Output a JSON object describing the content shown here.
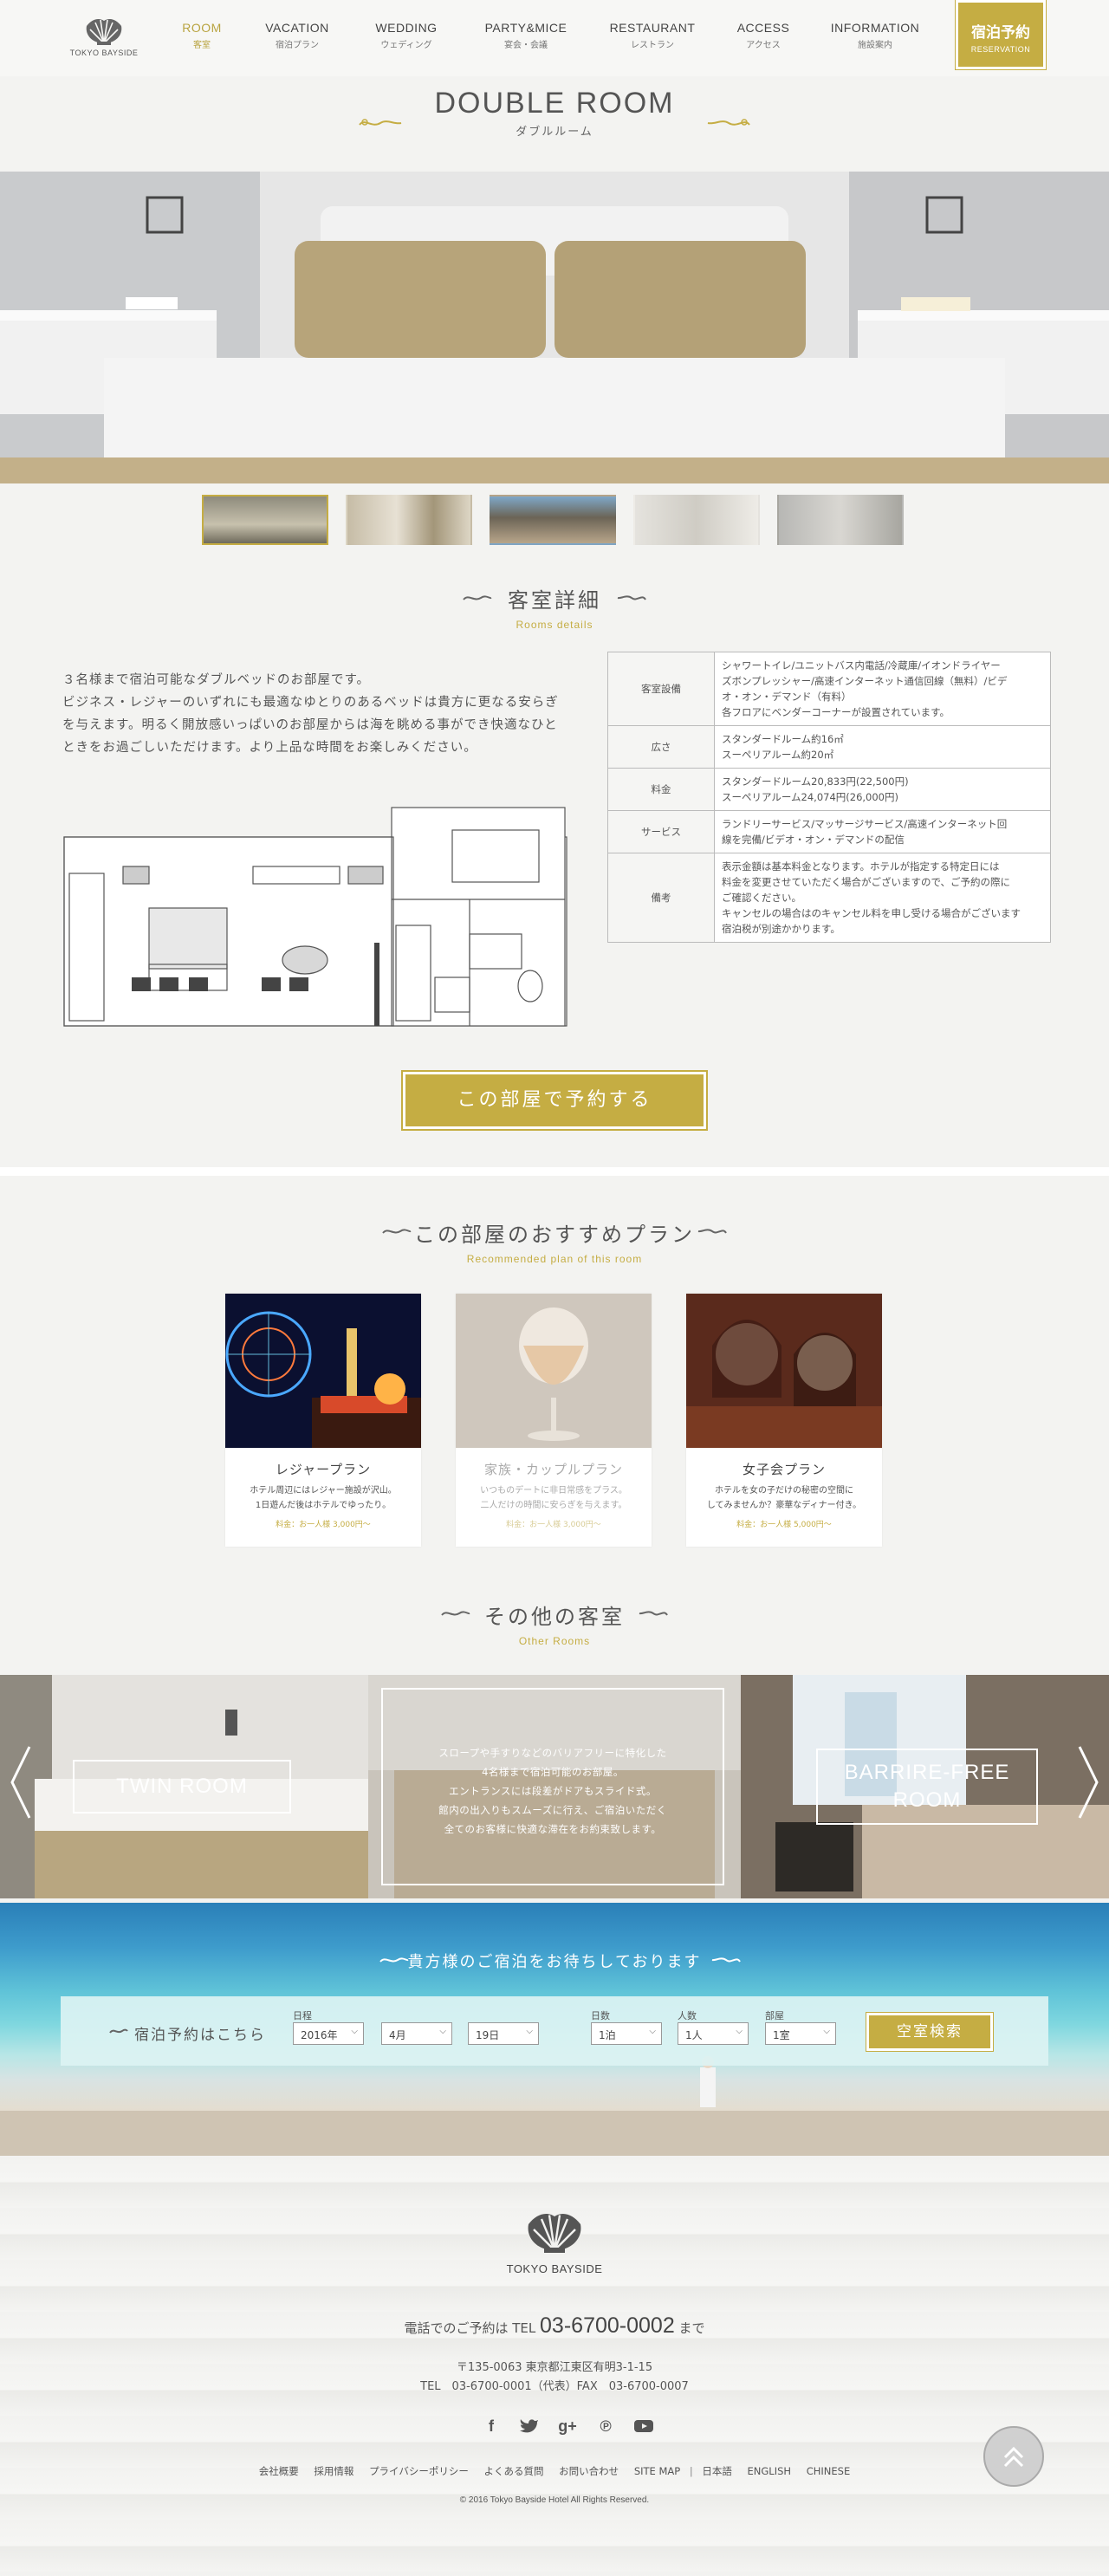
{
  "header": {
    "logo_text": "TOKYO BAYSIDE",
    "nav": [
      {
        "en": "ROOM",
        "ja": "客室",
        "active": true
      },
      {
        "en": "VACATION",
        "ja": "宿泊プラン",
        "active": false
      },
      {
        "en": "WEDDING",
        "ja": "ウェディング",
        "active": false
      },
      {
        "en": "PARTY&MICE",
        "ja": "宴会・会議",
        "active": false
      },
      {
        "en": "RESTAURANT",
        "ja": "レストラン",
        "active": false
      },
      {
        "en": "ACCESS",
        "ja": "アクセス",
        "active": false
      },
      {
        "en": "INFORMATION",
        "ja": "施設案内",
        "active": false
      }
    ],
    "reserve": {
      "ja": "宿泊予約",
      "en": "RESERVATION"
    }
  },
  "page_title": {
    "en": "DOUBLE ROOM",
    "ja": "ダブルルーム"
  },
  "details_section": {
    "heading_ja": "客室詳細",
    "heading_en": "Rooms details",
    "description": [
      "３名様まで宿泊可能なダブルベッドのお部屋です。",
      "ビジネス・レジャーのいずれにも最適なゆとりのあるベッドは貴方に更なる安らぎ",
      "を与えます。明るく開放感いっぱいのお部屋からは海を眺める事ができ快適なひと",
      "ときをお過ごしいただけます。より上品な時間をお楽しみください。"
    ],
    "table": [
      {
        "key": "客室設備",
        "lines": [
          "シャワートイレ/ユニットバス内電話/冷蔵庫/イオンドライヤー",
          "ズボンプレッシャー/高速インターネット通信回線（無料）/ビデ",
          "オ・オン・デマンド（有料）",
          "各フロアにベンダーコーナーが設置されています。"
        ]
      },
      {
        "key": "広さ",
        "lines": [
          "スタンダードルーム約16㎡",
          "スーペリアルーム約20㎡"
        ]
      },
      {
        "key": "料金",
        "lines": [
          "スタンダードルーム20,833円(22,500円)",
          "スーペリアルーム24,074円(26,000円)"
        ]
      },
      {
        "key": "サービス",
        "lines": [
          "ランドリーサービス/マッサージサービス/高速インターネット回",
          "線を完備/ビデオ・オン・デマンドの配信"
        ]
      },
      {
        "key": "備考",
        "lines": [
          "表示金額は基本料金となります。ホテルが指定する特定日には",
          "料金を変更させていただく場合がございますので、ご予約の際に",
          "ご確認ください。",
          "キャンセルの場合はのキャンセル料を申し受ける場合がございます",
          "宿泊税が別途かかります。"
        ]
      }
    ],
    "book_button": "この部屋で予約する"
  },
  "plans_section": {
    "heading_ja": "この部屋のおすすめプラン",
    "heading_en": "Recommended plan of this room",
    "plans": [
      {
        "title": "レジャープラン",
        "text": [
          "ホテル周辺にはレジャー施設が沢山。",
          "1日遊んだ後はホテルでゆったり。"
        ],
        "price": "料金：お一人様 3,000円～"
      },
      {
        "title": "家族・カップルプラン",
        "text": [
          "いつものデートに非日常感をプラス。",
          "二人だけの時間に安らぎを与えます。"
        ],
        "price": "料金：お一人様 3,000円～"
      },
      {
        "title": "女子会プラン",
        "text": [
          "ホテルを女の子だけの秘密の空間に",
          "してみませんか？豪華なディナー付き。"
        ],
        "price": "料金：お一人様 5,000円～"
      }
    ]
  },
  "other_rooms": {
    "heading_ja": "その他の客室",
    "heading_en": "Other Rooms",
    "twin_label": "TWIN ROOM",
    "barrier_label": "BARRIRE-FREE ROOM",
    "info_lines": [
      "スロープや手すりなどのバリアフリーに特化した",
      "4名様まで宿泊可能のお部屋。",
      "エントランスには段差がドアもスライド式。",
      "館内の出入りもスムーズに行え、ご宿泊いただく",
      "全てのお客様に快適な滞在をお約束致します。"
    ]
  },
  "reservation": {
    "title": "貴方様のご宿泊をお待ちしております",
    "label": "宿泊予約はこちら",
    "date_label": "日程",
    "nights_label": "日数",
    "people_label": "人数",
    "rooms_label": "部屋",
    "year": "2016年",
    "month": "4月",
    "day": "19日",
    "nights": "1泊",
    "people": "1人",
    "rooms": "1室",
    "search": "空室検索"
  },
  "footer": {
    "logo_text": "TOKYO BAYSIDE",
    "tel_prefix": "電話でのご予約は TEL",
    "tel_number": "03-6700-0002",
    "tel_suffix": "まで",
    "address": "〒135-0063 東京都江東区有明3-1-15",
    "tel_fax": "TEL　03-6700-0001（代表）FAX　03-6700-0007",
    "links": [
      "会社概要",
      "採用情報",
      "プライバシーポリシー",
      "よくある質問",
      "お問い合わせ",
      "SITE MAP"
    ],
    "lang_links": [
      "日本語",
      "ENGLISH",
      "CHINESE"
    ],
    "copyright": "© 2016 Tokyo Bayside Hotel All Rights Reserved."
  },
  "colors": {
    "accent": "#c5ad43",
    "text": "#555555",
    "background": "#f3f3f1"
  }
}
